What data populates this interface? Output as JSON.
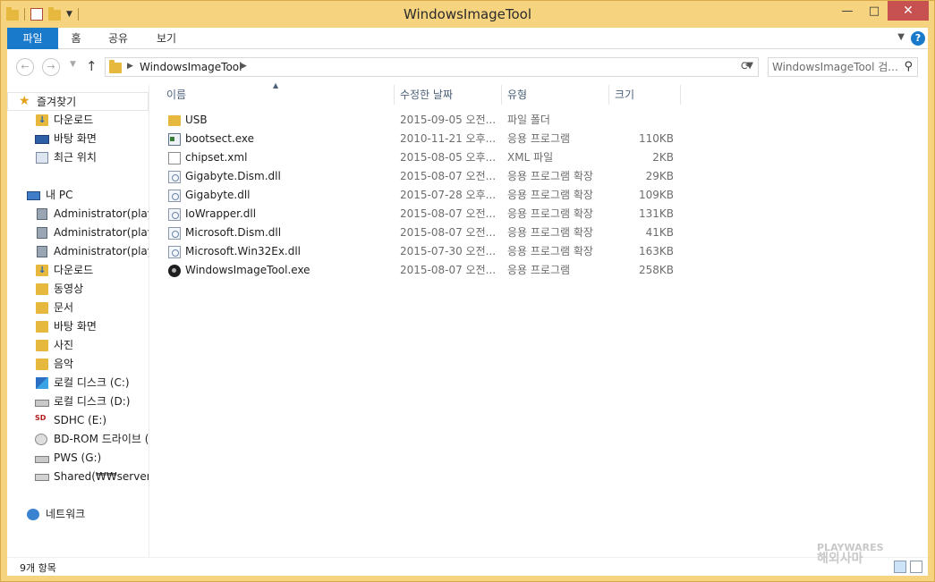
{
  "window": {
    "title": "WindowsImageTool",
    "minimize": "—",
    "maximize": "□",
    "close": "✕"
  },
  "ribbon": {
    "tabs": [
      "파일",
      "홈",
      "공유",
      "보기"
    ],
    "expand_icon": "chevron-down-icon",
    "help": "?"
  },
  "address": {
    "back": "←",
    "forward": "→",
    "up": "↑",
    "crumb": "WindowsImageTool",
    "search_placeholder": "WindowsImageTool 검..."
  },
  "nav": {
    "favorites_label": "즐겨찾기",
    "favorites": [
      "다운로드",
      "바탕 화면",
      "최근 위치"
    ],
    "pc_label": "내 PC",
    "pc_items": [
      "Administrator(playw",
      "Administrator(playw",
      "Administrator(playw",
      "다운로드",
      "동영상",
      "문서",
      "바탕 화면",
      "사진",
      "음악",
      "로컬 디스크 (C:)",
      "로컬 디스크 (D:)",
      "SDHC (E:)",
      "BD-ROM 드라이브 (",
      "PWS (G:)",
      "Shared(₩₩server) (Z"
    ],
    "network_label": "네트워크"
  },
  "columns": {
    "name": "이름",
    "date": "수정한 날짜",
    "type": "유형",
    "size": "크기"
  },
  "files": [
    {
      "name": "USB",
      "date": "2015-09-05 오전...",
      "type": "파일 폴더",
      "size": "",
      "icon": "folder"
    },
    {
      "name": "bootsect.exe",
      "date": "2010-11-21 오후...",
      "type": "응용 프로그램",
      "size": "110KB",
      "icon": "exe"
    },
    {
      "name": "chipset.xml",
      "date": "2015-08-05 오후...",
      "type": "XML 파일",
      "size": "2KB",
      "icon": "xml"
    },
    {
      "name": "Gigabyte.Dism.dll",
      "date": "2015-08-07 오전...",
      "type": "응용 프로그램 확장",
      "size": "29KB",
      "icon": "dll"
    },
    {
      "name": "Gigabyte.dll",
      "date": "2015-07-28 오후...",
      "type": "응용 프로그램 확장",
      "size": "109KB",
      "icon": "dll"
    },
    {
      "name": "IoWrapper.dll",
      "date": "2015-08-07 오전...",
      "type": "응용 프로그램 확장",
      "size": "131KB",
      "icon": "dll"
    },
    {
      "name": "Microsoft.Dism.dll",
      "date": "2015-08-07 오전...",
      "type": "응용 프로그램 확장",
      "size": "41KB",
      "icon": "dll"
    },
    {
      "name": "Microsoft.Win32Ex.dll",
      "date": "2015-07-30 오전...",
      "type": "응용 프로그램 확장",
      "size": "163KB",
      "icon": "dll"
    },
    {
      "name": "WindowsImageTool.exe",
      "date": "2015-08-07 오전...",
      "type": "응용 프로그램",
      "size": "258KB",
      "icon": "app"
    }
  ],
  "status": {
    "count": "9개 항목"
  },
  "watermark": {
    "line1": "PLAYWARES",
    "line2": "해외사마"
  },
  "colors": {
    "frame": "#f6d37e",
    "accent": "#1979ca",
    "close": "#c75050"
  }
}
